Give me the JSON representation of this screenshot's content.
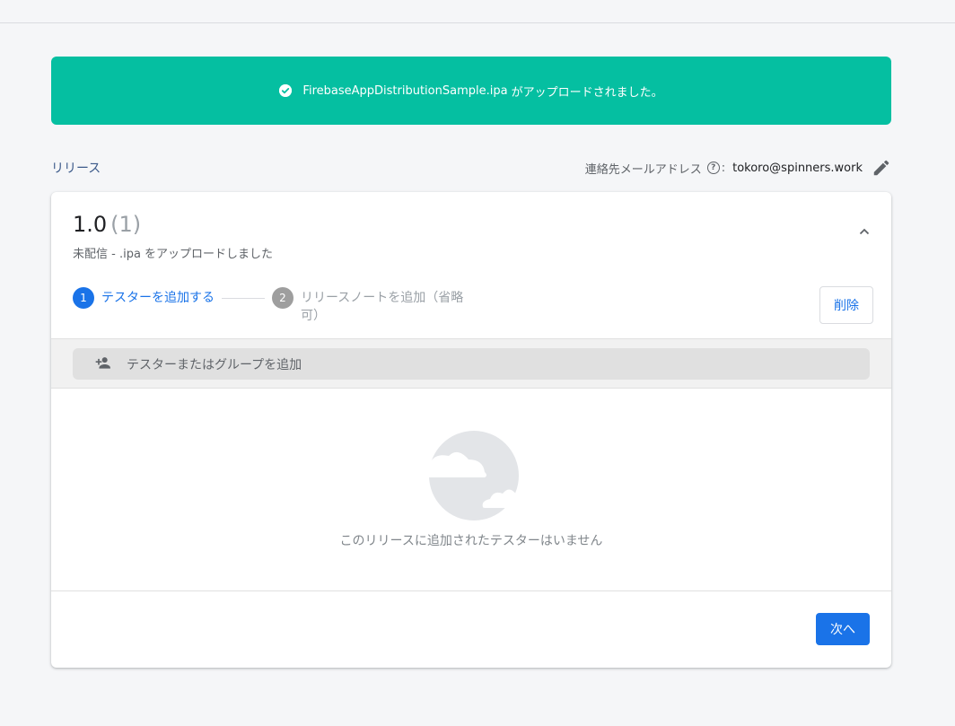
{
  "banner": {
    "filename": "FirebaseAppDistributionSample.ipa",
    "message": "がアップロードされました。",
    "icon": "check-circle-icon",
    "color": "#05bfa1"
  },
  "section": {
    "title": "リリース",
    "contact_label": "連絡先メールアドレス",
    "contact_colon": ":",
    "contact_email": "tokoro@spinners.work"
  },
  "release": {
    "version": "1.0",
    "build_count": "(1)",
    "subtitle": "未配信 - .ipa をアップロードしました",
    "steps": [
      {
        "number": "1",
        "label": "テスターを追加する",
        "state": "active"
      },
      {
        "number": "2",
        "label": "リリースノートを追加（省略可）",
        "state": "inactive"
      }
    ],
    "delete_label": "削除",
    "add_tester_placeholder": "テスターまたはグループを追加",
    "empty_message": "このリリースに追加されたテスターはいません",
    "next_label": "次へ"
  },
  "colors": {
    "accent": "#1a73e8",
    "success": "#05bfa1"
  }
}
